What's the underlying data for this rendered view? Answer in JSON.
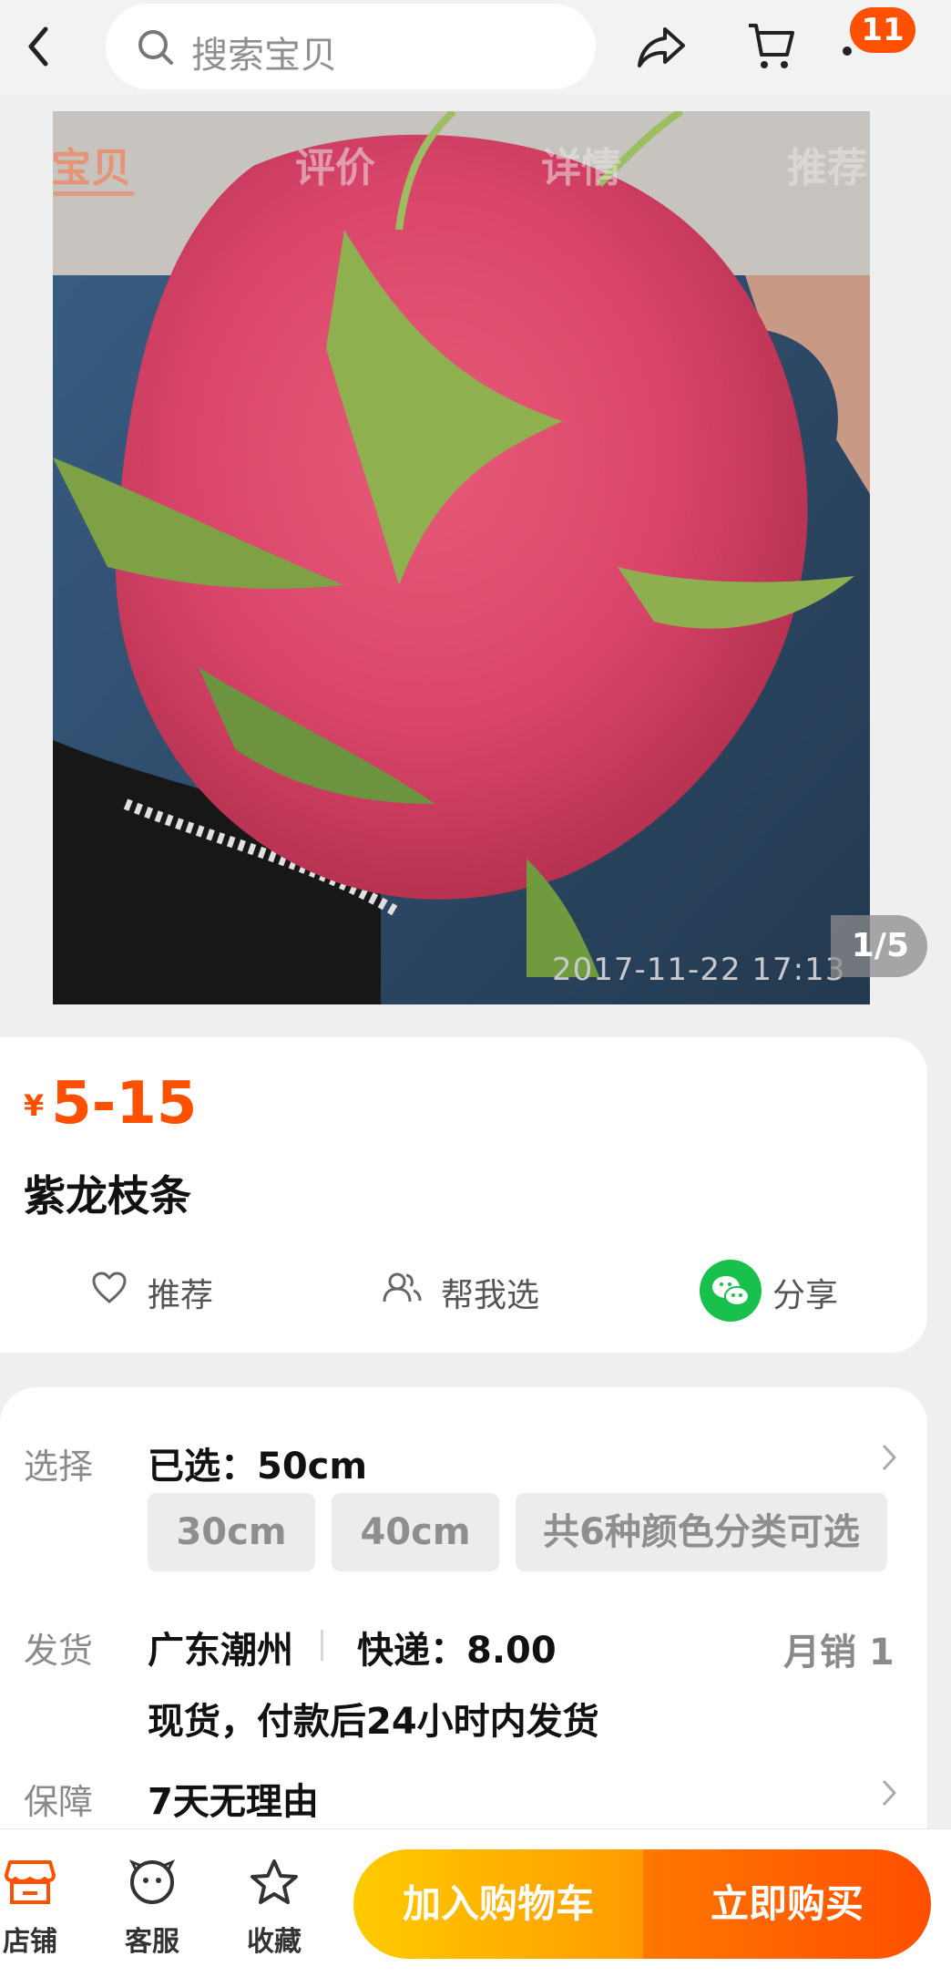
{
  "header": {
    "search_placeholder": "搜索宝贝",
    "cart_badge": "11"
  },
  "nav_tabs": [
    "宝贝",
    "评价",
    "详情",
    "推荐"
  ],
  "gallery": {
    "photo_timestamp": "2017-11-22  17:13",
    "pager": "1/5"
  },
  "product": {
    "currency": "¥",
    "price": "5-15",
    "title": "紫龙枝条"
  },
  "actions": {
    "recommend": "推荐",
    "help_choose": "帮我选",
    "share": "分享"
  },
  "specs": {
    "select_label": "选择",
    "selected": "已选：50cm",
    "options": [
      "30cm",
      "40cm",
      "共6种颜色分类可选"
    ],
    "ship_label": "发货",
    "origin": "广东潮州",
    "express": "快递：8.00",
    "monthly_sales": "月销  1",
    "ship_note": "现货，付款后24小时内发货",
    "guarantee_label": "保障",
    "guarantee": "7天无理由"
  },
  "bottom_bar": {
    "store": "店铺",
    "service": "客服",
    "favorite": "收藏",
    "add_to_cart": "加入购物车",
    "buy_now": "立即购买"
  },
  "colors": {
    "accent": "#ff5000",
    "cart_button": "#ffb300",
    "buy_button": "#ff5a00",
    "wechat": "#18c04c"
  }
}
